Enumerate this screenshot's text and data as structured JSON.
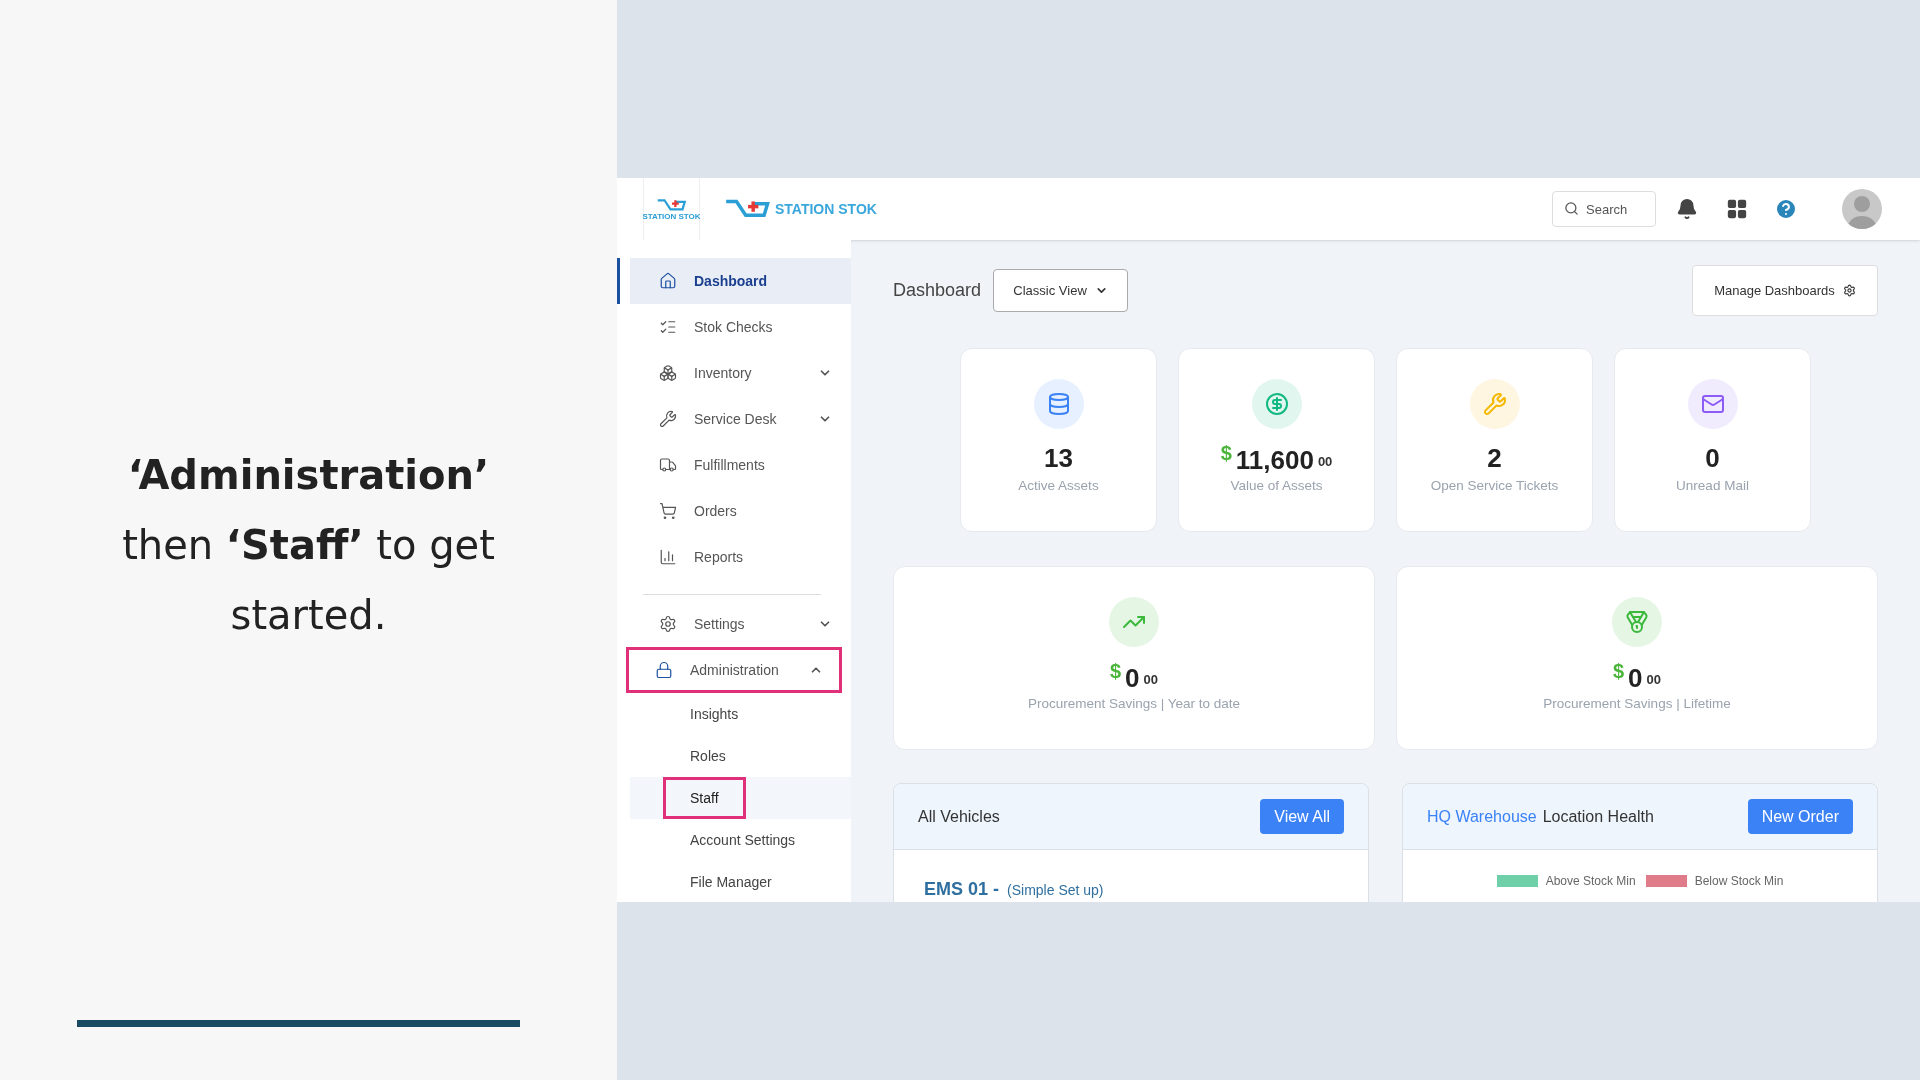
{
  "slide": {
    "text": "**‘Administration’** then **‘Staff’** to get started."
  },
  "header": {
    "logo_small_text": "STATION STOK",
    "logo_text": "STATION STOK",
    "search": {
      "placeholder": "Search"
    }
  },
  "sidebar": {
    "sections": [
      {
        "items": [
          {
            "label": "Dashboard",
            "kind": "link",
            "selected": true,
            "highlighted": false
          },
          {
            "label": "Stok Checks",
            "kind": "link",
            "selected": false,
            "highlighted": false
          },
          {
            "label": "Inventory",
            "kind": "menu",
            "expanded": false,
            "selected": false,
            "highlighted": false
          },
          {
            "label": "Service Desk",
            "kind": "menu",
            "expanded": false,
            "selected": false,
            "highlighted": false
          },
          {
            "label": "Fulfillments",
            "kind": "link",
            "selected": false,
            "highlighted": false
          },
          {
            "label": "Orders",
            "kind": "link",
            "selected": false,
            "highlighted": false
          },
          {
            "label": "Reports",
            "kind": "link",
            "selected": false,
            "highlighted": false
          }
        ]
      },
      {
        "items": [
          {
            "label": "Settings",
            "kind": "menu",
            "expanded": false,
            "selected": false,
            "highlighted": false
          },
          {
            "label": "Administration",
            "kind": "menu",
            "expanded": true,
            "selected": false,
            "highlighted": true,
            "children": [
              {
                "label": "Insights",
                "selected": false,
                "highlighted": false
              },
              {
                "label": "Roles",
                "selected": false,
                "highlighted": false
              },
              {
                "label": "Staff",
                "selected": true,
                "highlighted": true
              },
              {
                "label": "Account Settings",
                "selected": false,
                "highlighted": false
              },
              {
                "label": "File Manager",
                "selected": false,
                "highlighted": false
              }
            ]
          }
        ]
      }
    ]
  },
  "main": {
    "title": "Dashboard",
    "view_select": "Classic View",
    "manage_button": "Manage Dashboards",
    "stats": [
      {
        "kind": "count",
        "value": "13",
        "label": "Active Assets",
        "color": "#3b82f6"
      },
      {
        "kind": "money",
        "currency": "$",
        "value": "11,600",
        "cents": "00",
        "label": "Value of Assets",
        "color": "#10b981"
      },
      {
        "kind": "count",
        "value": "2",
        "label": "Open Service Tickets",
        "color": "#f5b800"
      },
      {
        "kind": "count",
        "value": "0",
        "label": "Unread Mail",
        "color": "#8b5cf6"
      }
    ],
    "savings": [
      {
        "currency": "$",
        "value": "0",
        "cents": "00",
        "label": "Procurement Savings | Year to date",
        "color": "#3cb83c"
      },
      {
        "currency": "$",
        "value": "0",
        "cents": "00",
        "label": "Procurement Savings | Lifetime",
        "color": "#3cb83c"
      }
    ],
    "vehicles": {
      "title": "All Vehicles",
      "button": "View All",
      "first_vehicle": "EMS 01 -",
      "first_vehicle_note": "(Simple Set up)"
    },
    "location": {
      "location": "HQ Warehouse",
      "title": "Location Health",
      "button": "New Order",
      "legend": [
        {
          "label": "Above Stock Min",
          "color": "#6fcfa8"
        },
        {
          "label": "Below Stock Min",
          "color": "#e07b8a"
        }
      ]
    }
  }
}
